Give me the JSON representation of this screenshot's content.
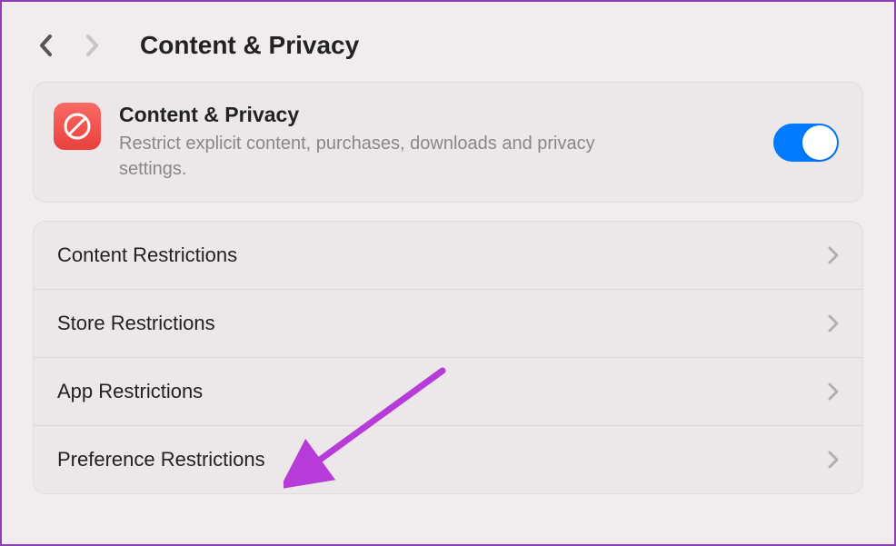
{
  "header": {
    "title": "Content & Privacy"
  },
  "topCard": {
    "title": "Content & Privacy",
    "description": "Restrict explicit content, purchases, downloads and privacy settings.",
    "iconName": "no-symbol-icon",
    "toggle": true
  },
  "rows": [
    {
      "label": "Content Restrictions"
    },
    {
      "label": "Store Restrictions"
    },
    {
      "label": "App Restrictions"
    },
    {
      "label": "Preference Restrictions"
    }
  ],
  "colors": {
    "accent": "#007aff",
    "arrow": "#b63bd9"
  }
}
